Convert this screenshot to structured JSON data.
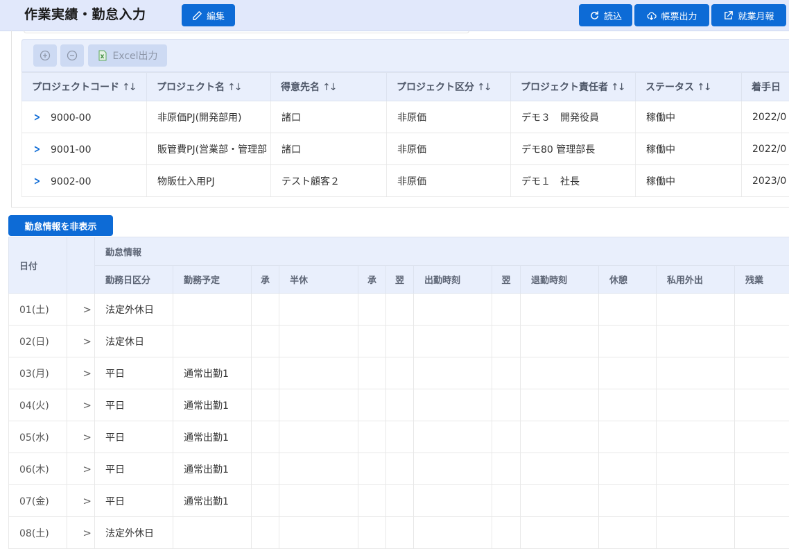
{
  "header": {
    "title": "作業実績・勤怠入力",
    "edit_label": "編集",
    "reload_label": "読込",
    "report_label": "帳票出力",
    "monthly_label": "就業月報"
  },
  "toolbar": {
    "excel_label": "Excel出力"
  },
  "projects": {
    "columns": [
      "プロジェクトコード",
      "プロジェクト名",
      "得意先名",
      "プロジェクト区分",
      "プロジェクト責任者",
      "ステータス",
      "着手日"
    ],
    "rows": [
      {
        "code": "9000-00",
        "name": "非原価PJ(開発部用)",
        "client": "諸口",
        "category": "非原価",
        "manager": "デモ３　開発役員",
        "status": "稼働中",
        "start": "2022/0"
      },
      {
        "code": "9001-00",
        "name": "販管費PJ(営業部・管理部",
        "client": "諸口",
        "category": "非原価",
        "manager": "デモ80 管理部長",
        "status": "稼働中",
        "start": "2022/0"
      },
      {
        "code": "9002-00",
        "name": "物販仕入用PJ",
        "client": "テスト顧客２",
        "category": "非原価",
        "manager": "デモ１　社長",
        "status": "稼働中",
        "start": "2023/0"
      }
    ]
  },
  "attendance": {
    "toggle_label": "勤怠情報を非表示",
    "date_header": "日付",
    "group_header": "勤怠情報",
    "columns": [
      "勤務日区分",
      "勤務予定",
      "承",
      "半休",
      "承",
      "翌",
      "出勤時刻",
      "翌",
      "退勤時刻",
      "休憩",
      "私用外出",
      "残業"
    ],
    "rows": [
      {
        "date": "01(土)",
        "kubun": "法定外休日",
        "yotei": ""
      },
      {
        "date": "02(日)",
        "kubun": "法定休日",
        "yotei": ""
      },
      {
        "date": "03(月)",
        "kubun": "平日",
        "yotei": "通常出勤1"
      },
      {
        "date": "04(火)",
        "kubun": "平日",
        "yotei": "通常出勤1"
      },
      {
        "date": "05(水)",
        "kubun": "平日",
        "yotei": "通常出勤1"
      },
      {
        "date": "06(木)",
        "kubun": "平日",
        "yotei": "通常出勤1"
      },
      {
        "date": "07(金)",
        "kubun": "平日",
        "yotei": "通常出勤1"
      },
      {
        "date": "08(土)",
        "kubun": "法定外休日",
        "yotei": ""
      }
    ]
  }
}
